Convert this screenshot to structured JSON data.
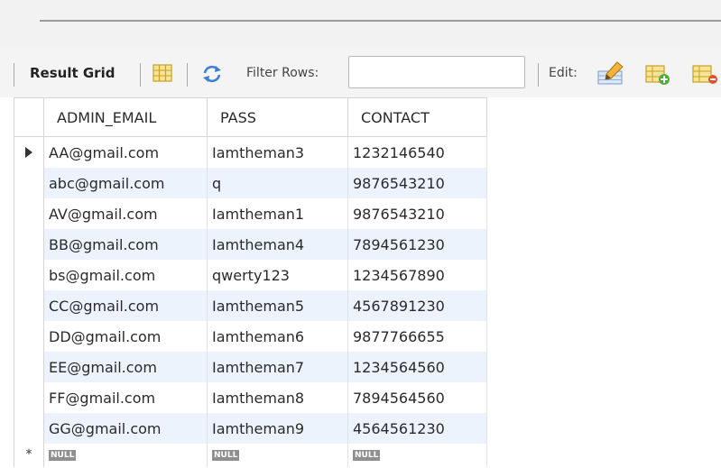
{
  "toolbar": {
    "result_grid_label": "Result Grid",
    "filter_label": "Filter Rows:",
    "filter_value": "",
    "edit_label": "Edit:"
  },
  "icons": {
    "grid": "grid-layout-icon",
    "refresh": "refresh-icon",
    "edit": "edit-pencil-icon",
    "add_row": "add-row-icon",
    "delete_row": "delete-row-icon"
  },
  "table": {
    "columns": [
      "ADMIN_EMAIL",
      "PASS",
      "CONTACT"
    ],
    "rows": [
      [
        "AA@gmail.com",
        "Iamtheman3",
        "1232146540"
      ],
      [
        "abc@gmail.com",
        "q",
        "9876543210"
      ],
      [
        "AV@gmail.com",
        "Iamtheman1",
        "9876543210"
      ],
      [
        "BB@gmail.com",
        "Iamtheman4",
        "7894561230"
      ],
      [
        "bs@gmail.com",
        "qwerty123",
        "1234567890"
      ],
      [
        "CC@gmail.com",
        "Iamtheman5",
        "4567891230"
      ],
      [
        "DD@gmail.com",
        "Iamtheman6",
        "9877766655"
      ],
      [
        "EE@gmail.com",
        "Iamtheman7",
        "1234564560"
      ],
      [
        "FF@gmail.com",
        "Iamtheman8",
        "7894564560"
      ],
      [
        "GG@gmail.com",
        "Iamtheman9",
        "4564561230"
      ]
    ],
    "null_label": "NULL",
    "new_row_marker": "*"
  },
  "colors": {
    "stripe": "#edf3fc",
    "null_badge": "#8f8f8f",
    "refresh_blue": "#3d7fd6"
  }
}
